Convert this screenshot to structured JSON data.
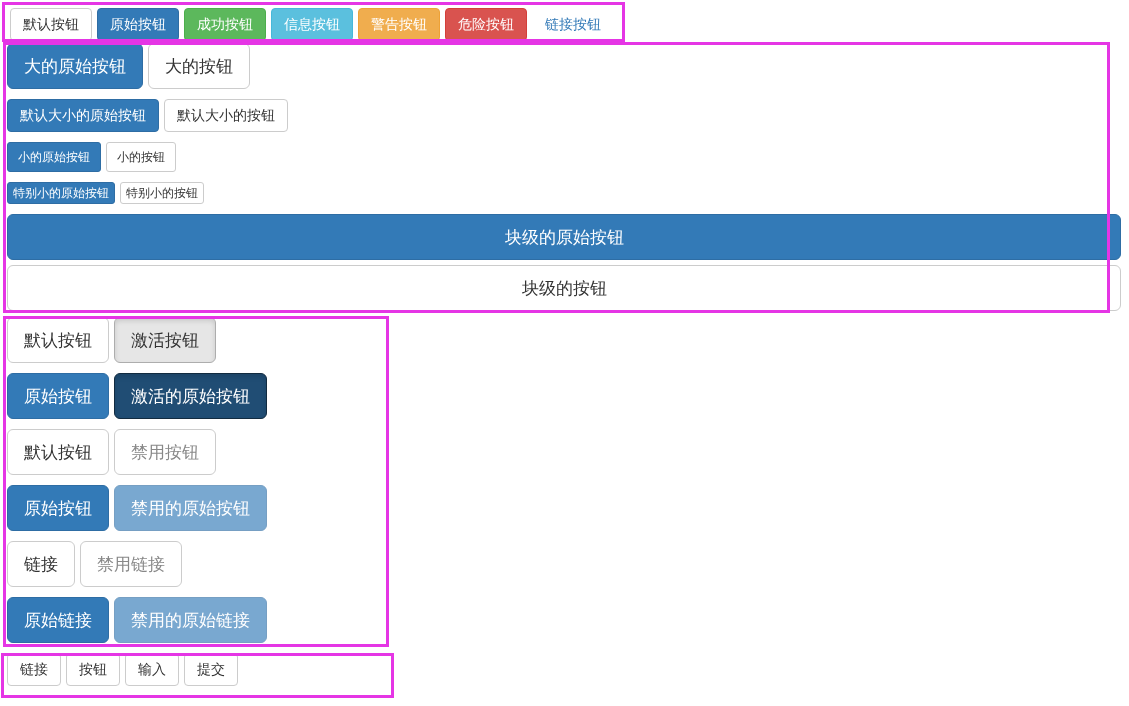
{
  "sections": [
    {
      "rows": [
        {
          "kind": "medium",
          "buttons": [
            {
              "label": "默认按钮",
              "kind": "default",
              "active": false,
              "disabled": false
            },
            {
              "label": "原始按钮",
              "kind": "primary",
              "active": false,
              "disabled": false
            },
            {
              "label": "成功按钮",
              "kind": "success",
              "active": false,
              "disabled": false
            },
            {
              "label": "信息按钮",
              "kind": "info",
              "active": false,
              "disabled": false
            },
            {
              "label": "警告按钮",
              "kind": "warning",
              "active": false,
              "disabled": false
            },
            {
              "label": "危险按钮",
              "kind": "danger",
              "active": false,
              "disabled": false
            },
            {
              "label": "链接按钮",
              "kind": "link",
              "active": false,
              "disabled": false
            }
          ]
        }
      ]
    },
    {
      "rows": [
        {
          "kind": "large",
          "buttons": [
            {
              "label": "大的原始按钮",
              "kind": "primary",
              "active": false,
              "disabled": false
            },
            {
              "label": "大的按钮",
              "kind": "default",
              "active": false,
              "disabled": false
            }
          ]
        },
        {
          "kind": "medium",
          "buttons": [
            {
              "label": "默认大小的原始按钮",
              "kind": "primary",
              "active": false,
              "disabled": false
            },
            {
              "label": "默认大小的按钮",
              "kind": "default",
              "active": false,
              "disabled": false
            }
          ]
        },
        {
          "kind": "small",
          "buttons": [
            {
              "label": "小的原始按钮",
              "kind": "primary",
              "active": false,
              "disabled": false
            },
            {
              "label": "小的按钮",
              "kind": "default",
              "active": false,
              "disabled": false
            }
          ]
        },
        {
          "kind": "tiny",
          "buttons": [
            {
              "label": "特别小的原始按钮",
              "kind": "primary",
              "active": false,
              "disabled": false
            },
            {
              "label": "特别小的按钮",
              "kind": "default",
              "active": false,
              "disabled": false
            }
          ]
        },
        {
          "kind": "block",
          "buttons": [
            {
              "label": "块级的原始按钮",
              "kind": "primary",
              "active": false,
              "disabled": false
            }
          ]
        },
        {
          "kind": "block",
          "buttons": [
            {
              "label": "块级的按钮",
              "kind": "default",
              "active": false,
              "disabled": false
            }
          ]
        }
      ]
    },
    {
      "rows": [
        {
          "kind": "large",
          "buttons": [
            {
              "label": "默认按钮",
              "kind": "default",
              "active": false,
              "disabled": false
            },
            {
              "label": "激活按钮",
              "kind": "default",
              "active": true,
              "disabled": false
            }
          ]
        },
        {
          "kind": "large",
          "buttons": [
            {
              "label": "原始按钮",
              "kind": "primary",
              "active": false,
              "disabled": false
            },
            {
              "label": "激活的原始按钮",
              "kind": "primary",
              "active": true,
              "disabled": false
            }
          ]
        },
        {
          "kind": "large",
          "buttons": [
            {
              "label": "默认按钮",
              "kind": "default",
              "active": false,
              "disabled": false
            },
            {
              "label": "禁用按钮",
              "kind": "default",
              "active": false,
              "disabled": true
            }
          ]
        },
        {
          "kind": "large",
          "buttons": [
            {
              "label": "原始按钮",
              "kind": "primary",
              "active": false,
              "disabled": false
            },
            {
              "label": "禁用的原始按钮",
              "kind": "primary",
              "active": false,
              "disabled": true
            }
          ]
        },
        {
          "kind": "large",
          "buttons": [
            {
              "label": "链接",
              "kind": "default",
              "active": false,
              "disabled": false
            },
            {
              "label": "禁用链接",
              "kind": "default",
              "active": false,
              "disabled": true
            }
          ]
        },
        {
          "kind": "large",
          "buttons": [
            {
              "label": "原始链接",
              "kind": "primary",
              "active": false,
              "disabled": false
            },
            {
              "label": "禁用的原始链接",
              "kind": "primary",
              "active": false,
              "disabled": true
            }
          ]
        }
      ]
    },
    {
      "rows": [
        {
          "kind": "medium",
          "buttons": [
            {
              "label": "链接",
              "kind": "default",
              "active": false,
              "disabled": false
            },
            {
              "label": "按钮",
              "kind": "default",
              "active": false,
              "disabled": false
            },
            {
              "label": "输入",
              "kind": "default",
              "active": false,
              "disabled": false
            },
            {
              "label": "提交",
              "kind": "default",
              "active": false,
              "disabled": false
            }
          ]
        }
      ]
    }
  ]
}
